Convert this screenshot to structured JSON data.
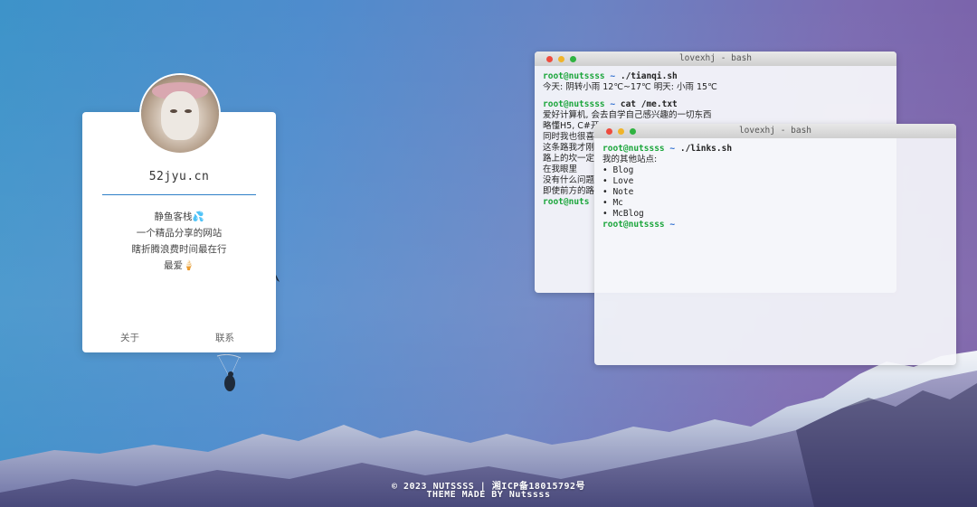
{
  "profile": {
    "site": "52jyu.cn",
    "description": [
      "静鱼客栈💦",
      "一个精品分享的网站",
      "瞎折腾浪费时间最在行",
      "最爱🍦"
    ],
    "links": {
      "about": "关于",
      "contact": "联系"
    }
  },
  "terminal1": {
    "title": "lovexhj - bash",
    "prompt_user": "root@nutssss",
    "prompt_tilde": "~",
    "cmd1": "./tianqi.sh",
    "out1": "今天: 阴转小雨 12℃~17℃ 明天: 小雨 15℃",
    "cmd2": "cat /me.txt",
    "lines": [
      "爱好计算机, 会去自学自己感兴趣的一切东西",
      "略懂H5, C#开",
      "同时我也很喜",
      "这条路我才刚",
      "路上的坎一定",
      "在我眼里",
      "没有什么问题",
      "即使前方的路"
    ],
    "prompt_end": "root@nuts"
  },
  "terminal2": {
    "title": "lovexhj - bash",
    "prompt_user": "root@nutssss",
    "prompt_tilde": "~",
    "cmd": "./links.sh",
    "heading": "我的其他站点:",
    "items": [
      "• Blog",
      "• Love",
      "• Note",
      "• Mc",
      "• McBlog"
    ],
    "prompt_end_user": "root@nutssss",
    "prompt_end_tilde": "~"
  },
  "footer": {
    "line1": "© 2023 NUTSSSS | 湘ICP备18015792号",
    "line2": "THEME MADE BY Nutssss"
  },
  "colors": {
    "accent": "#2f80c8",
    "prompt_user": "#1aa53a",
    "prompt_tilde": "#2f6fd0"
  }
}
